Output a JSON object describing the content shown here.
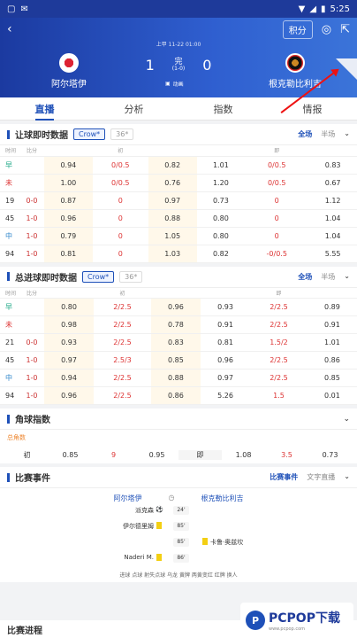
{
  "status": {
    "time": "5:25"
  },
  "header": {
    "score_btn": "积分",
    "meta": "上甲   11-22 01:00",
    "home_name": "阿尔塔伊",
    "away_name": "根克勒比利吉",
    "home_score": "1",
    "away_score": "0",
    "state": "完",
    "half": "(1-0)",
    "anim": "动画"
  },
  "tabs": [
    "直播",
    "分析",
    "指数",
    "情报"
  ],
  "handicap": {
    "title": "让球即时数据",
    "chip_on": "Crow*",
    "chip_off": "36*",
    "full": "全场",
    "half": "半场",
    "hdr": [
      "时间",
      "比分",
      "初",
      "",
      "",
      "",
      "即",
      "",
      ""
    ],
    "rows": [
      {
        "t": "早",
        "s": "",
        "c": [
          "0.94",
          "0/0.5",
          "0.82",
          "1.01",
          "0/0.5",
          "0.83"
        ],
        "tc": "green"
      },
      {
        "t": "未",
        "s": "",
        "c": [
          "1.00",
          "0/0.5",
          "0.76",
          "1.20",
          "0/0.5",
          "0.67"
        ],
        "tc": "red"
      },
      {
        "t": "19",
        "s": "0-0",
        "c": [
          "0.87",
          "0",
          "0.97",
          "0.73",
          "0",
          "1.12"
        ],
        "tc": ""
      },
      {
        "t": "45",
        "s": "1-0",
        "c": [
          "0.96",
          "0",
          "0.88",
          "0.80",
          "0",
          "1.04"
        ],
        "tc": ""
      },
      {
        "t": "中",
        "s": "1-0",
        "c": [
          "0.79",
          "0",
          "1.05",
          "0.80",
          "0",
          "1.04"
        ],
        "tc": "blue"
      },
      {
        "t": "94",
        "s": "1-0",
        "c": [
          "0.81",
          "0",
          "1.03",
          "0.82",
          "-0/0.5",
          "5.55"
        ],
        "tc": ""
      }
    ]
  },
  "totals": {
    "title": "总进球即时数据",
    "chip_on": "Crow*",
    "chip_off": "36*",
    "full": "全场",
    "half": "半场",
    "hdr": [
      "时间",
      "比分",
      "初",
      "",
      "",
      "",
      "即",
      "",
      ""
    ],
    "rows": [
      {
        "t": "早",
        "s": "",
        "c": [
          "0.80",
          "2/2.5",
          "0.96",
          "0.93",
          "2/2.5",
          "0.89"
        ],
        "tc": "green"
      },
      {
        "t": "未",
        "s": "",
        "c": [
          "0.98",
          "2/2.5",
          "0.78",
          "0.91",
          "2/2.5",
          "0.91"
        ],
        "tc": "red"
      },
      {
        "t": "21",
        "s": "0-0",
        "c": [
          "0.93",
          "2/2.5",
          "0.83",
          "0.81",
          "1.5/2",
          "1.01"
        ],
        "tc": ""
      },
      {
        "t": "45",
        "s": "1-0",
        "c": [
          "0.97",
          "2.5/3",
          "0.85",
          "0.96",
          "2/2.5",
          "0.86"
        ],
        "tc": ""
      },
      {
        "t": "中",
        "s": "1-0",
        "c": [
          "0.94",
          "2/2.5",
          "0.88",
          "0.97",
          "2/2.5",
          "0.85"
        ],
        "tc": "blue"
      },
      {
        "t": "94",
        "s": "1-0",
        "c": [
          "0.96",
          "2/2.5",
          "0.86",
          "5.26",
          "1.5",
          "0.01"
        ],
        "tc": ""
      }
    ]
  },
  "corners": {
    "title": "角球指数",
    "sub": "总角数",
    "row": [
      "初",
      "0.85",
      "9",
      "0.95",
      "即",
      "1.08",
      "3.5",
      "0.73"
    ]
  },
  "events": {
    "title": "比赛事件",
    "tab_on": "比赛事件",
    "tab_off": "文字直播",
    "home": "阿尔塔伊",
    "away": "根克勒比利吉",
    "items": [
      {
        "left": "派克森",
        "min": "24'",
        "right": ""
      },
      {
        "left": "伊尔德里姆",
        "min": "85'",
        "right": ""
      },
      {
        "left": "",
        "min": "85'",
        "right": "卡鲁·奥兹坎"
      },
      {
        "left": "Naderi M.",
        "min": "86'",
        "right": ""
      }
    ],
    "legend": "进球  点球  射失点球  乌龙  黄牌  两黄变红  红牌  换人"
  },
  "bottom": {
    "title": "比赛进程"
  },
  "watermark": {
    "brand": "PCPOP下载",
    "sub": "www.pcpop.com"
  }
}
